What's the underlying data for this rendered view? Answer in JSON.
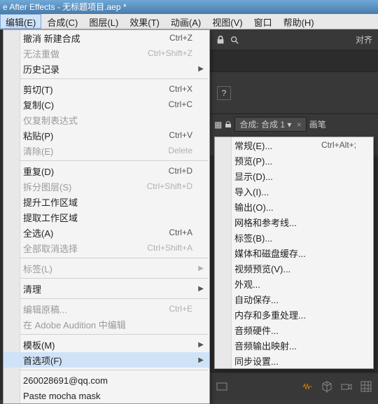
{
  "window": {
    "title": "e After Effects - 无标题项目.aep *"
  },
  "menubar": {
    "items": [
      {
        "label": "编辑(E)",
        "active": true
      },
      {
        "label": "合成(C)"
      },
      {
        "label": "图层(L)"
      },
      {
        "label": "效果(T)"
      },
      {
        "label": "动画(A)"
      },
      {
        "label": "视图(V)"
      },
      {
        "label": "窗口"
      },
      {
        "label": "帮助(H)"
      }
    ]
  },
  "toolbar": {
    "align_label": "对齐"
  },
  "comp": {
    "tab_prefix": "合成: ",
    "tab_name": "合成 1",
    "brush_label": "画笔",
    "sub_label": "合成 1"
  },
  "edit_menu": [
    {
      "label": "撤消 新建合成",
      "shortcut": "Ctrl+Z"
    },
    {
      "label": "无法重做",
      "shortcut": "Ctrl+Shift+Z",
      "disabled": true
    },
    {
      "label": "历史记录",
      "submenu": true
    },
    {
      "sep": true
    },
    {
      "label": "剪切(T)",
      "shortcut": "Ctrl+X"
    },
    {
      "label": "复制(C)",
      "shortcut": "Ctrl+C"
    },
    {
      "label": "仅复制表达式",
      "disabled": true
    },
    {
      "label": "粘贴(P)",
      "shortcut": "Ctrl+V"
    },
    {
      "label": "清除(E)",
      "shortcut": "Delete",
      "disabled": true
    },
    {
      "sep": true
    },
    {
      "label": "重复(D)",
      "shortcut": "Ctrl+D"
    },
    {
      "label": "拆分图层(S)",
      "shortcut": "Ctrl+Shift+D",
      "disabled": true
    },
    {
      "label": "提升工作区域"
    },
    {
      "label": "提取工作区域"
    },
    {
      "label": "全选(A)",
      "shortcut": "Ctrl+A"
    },
    {
      "label": "全部取消选择",
      "shortcut": "Ctrl+Shift+A",
      "disabled": true
    },
    {
      "sep": true
    },
    {
      "label": "标签(L)",
      "submenu": true,
      "disabled": true
    },
    {
      "sep": true
    },
    {
      "label": "清理",
      "submenu": true
    },
    {
      "sep": true
    },
    {
      "label": "编辑原稿...",
      "shortcut": "Ctrl+E",
      "disabled": true
    },
    {
      "label": "在 Adobe Audition 中编辑",
      "disabled": true
    },
    {
      "sep": true
    },
    {
      "label": "模板(M)",
      "submenu": true
    },
    {
      "label": "首选项(F)",
      "submenu": true,
      "hover": true
    },
    {
      "sep": true
    },
    {
      "label": "260028691@qq.com"
    },
    {
      "label": "Paste mocha mask"
    }
  ],
  "pref_menu": [
    {
      "label": "常规(E)...",
      "shortcut": "Ctrl+Alt+;"
    },
    {
      "label": "预览(P)..."
    },
    {
      "label": "显示(D)..."
    },
    {
      "label": "导入(I)..."
    },
    {
      "label": "输出(O)..."
    },
    {
      "label": "网格和参考线..."
    },
    {
      "label": "标签(B)..."
    },
    {
      "label": "媒体和磁盘缓存..."
    },
    {
      "label": "视频预览(V)..."
    },
    {
      "label": "外观..."
    },
    {
      "label": "自动保存..."
    },
    {
      "label": "内存和多重处理..."
    },
    {
      "label": "音频硬件..."
    },
    {
      "label": "音频输出映射..."
    },
    {
      "label": "同步设置..."
    }
  ],
  "bottom": {
    "zoom": ""
  }
}
